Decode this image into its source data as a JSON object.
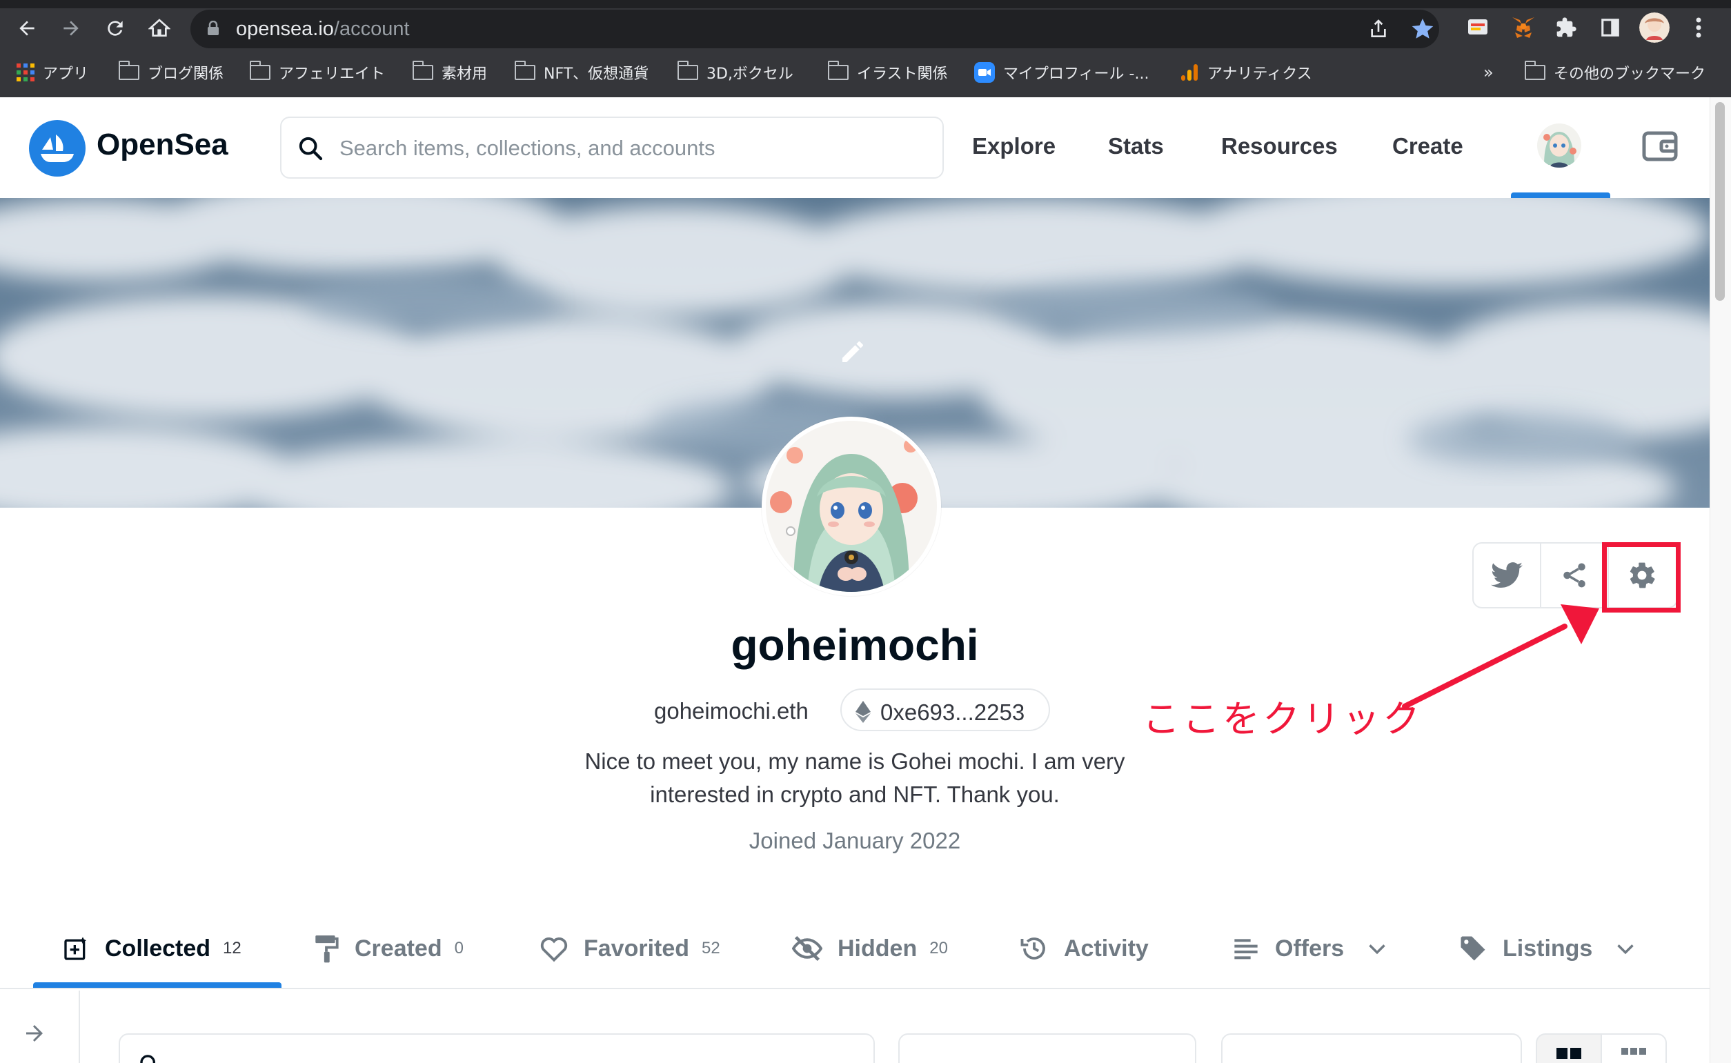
{
  "browser": {
    "url_host": "opensea.io",
    "url_path": "/account",
    "bookmarks": [
      {
        "label": "アプリ",
        "icon": "apps-grid-icon"
      },
      {
        "label": "ブログ関係",
        "icon": "folder-icon"
      },
      {
        "label": "アフェリエイト",
        "icon": "folder-icon"
      },
      {
        "label": "素材用",
        "icon": "folder-icon"
      },
      {
        "label": "NFT、仮想通貨",
        "icon": "folder-icon"
      },
      {
        "label": "3D,ボクセル",
        "icon": "folder-icon"
      },
      {
        "label": "イラスト関係",
        "icon": "folder-icon"
      },
      {
        "label": "マイプロフィール -...",
        "icon": "zoom-icon"
      },
      {
        "label": "アナリティクス",
        "icon": "analytics-icon"
      }
    ],
    "bookmarks_overflow": "»",
    "other_bookmarks": "その他のブックマーク"
  },
  "header": {
    "logo_text": "OpenSea",
    "search_placeholder": "Search items, collections, and accounts",
    "nav": [
      "Explore",
      "Stats",
      "Resources",
      "Create"
    ]
  },
  "profile": {
    "username": "goheimochi",
    "ens": "goheimochi.eth",
    "address": "0xe693...2253",
    "bio_line1": "Nice to meet you, my name is Gohei mochi. I am very",
    "bio_line2": "interested in crypto and NFT. Thank you.",
    "joined": "Joined January 2022"
  },
  "annotation": {
    "text": "ここをクリック",
    "color": "#f0173a"
  },
  "tabs": [
    {
      "label": "Collected",
      "count": "12",
      "icon": "collected-icon",
      "active": true
    },
    {
      "label": "Created",
      "count": "0",
      "icon": "paint-roller-icon",
      "active": false
    },
    {
      "label": "Favorited",
      "count": "52",
      "icon": "heart-icon",
      "active": false
    },
    {
      "label": "Hidden",
      "count": "20",
      "icon": "eye-off-icon",
      "active": false
    },
    {
      "label": "Activity",
      "count": "",
      "icon": "history-icon",
      "active": false
    },
    {
      "label": "Offers",
      "count": "",
      "icon": "list-icon",
      "active": false
    },
    {
      "label": "Listings",
      "count": "",
      "icon": "tag-icon",
      "active": false
    }
  ],
  "colors": {
    "accent": "#2081e2",
    "text_primary": "#04111d",
    "text_secondary": "#707a83",
    "annotation_red": "#f0173a"
  }
}
